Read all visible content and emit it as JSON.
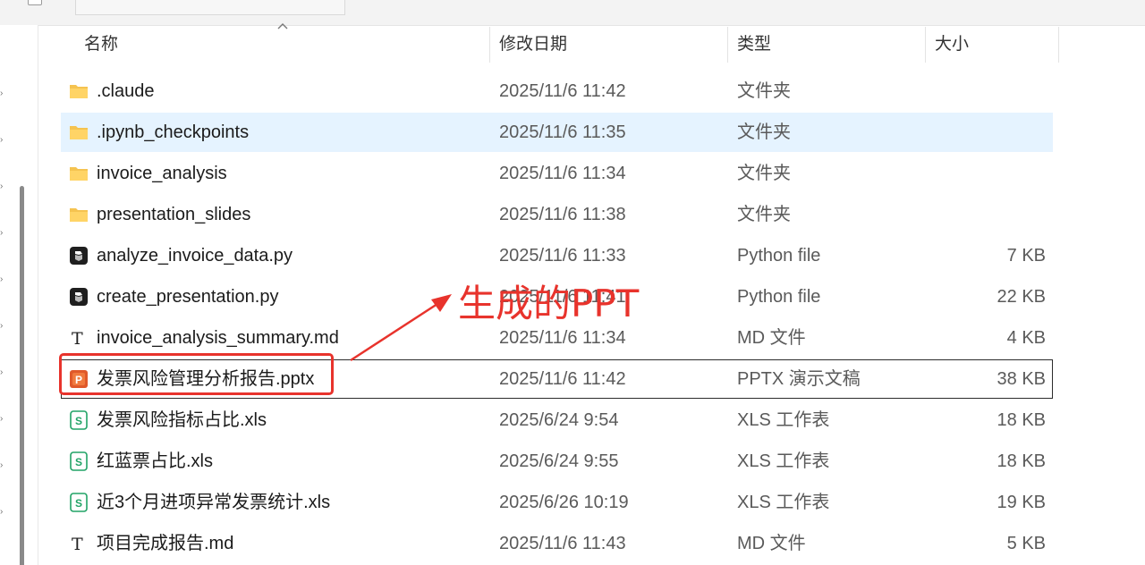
{
  "columns": {
    "name": "名称",
    "modified": "修改日期",
    "type": "类型",
    "size": "大小"
  },
  "files": [
    {
      "name": ".claude",
      "modified": "2025/11/6 11:42",
      "type": "文件夹",
      "size": "",
      "icon": "folder-icon"
    },
    {
      "name": ".ipynb_checkpoints",
      "modified": "2025/11/6 11:35",
      "type": "文件夹",
      "size": "",
      "icon": "folder-icon"
    },
    {
      "name": "invoice_analysis",
      "modified": "2025/11/6 11:34",
      "type": "文件夹",
      "size": "",
      "icon": "folder-icon"
    },
    {
      "name": "presentation_slides",
      "modified": "2025/11/6 11:38",
      "type": "文件夹",
      "size": "",
      "icon": "folder-icon"
    },
    {
      "name": "analyze_invoice_data.py",
      "modified": "2025/11/6 11:33",
      "type": "Python file",
      "size": "7 KB",
      "icon": "python-file-icon"
    },
    {
      "name": "create_presentation.py",
      "modified": "2025/11/6 11:41",
      "type": "Python file",
      "size": "22 KB",
      "icon": "python-file-icon"
    },
    {
      "name": "invoice_analysis_summary.md",
      "modified": "2025/11/6 11:34",
      "type": "MD 文件",
      "size": "4 KB",
      "icon": "markdown-file-icon"
    },
    {
      "name": "发票风险管理分析报告.pptx",
      "modified": "2025/11/6 11:42",
      "type": "PPTX 演示文稿",
      "size": "38 KB",
      "icon": "pptx-file-icon"
    },
    {
      "name": "发票风险指标占比.xls",
      "modified": "2025/6/24 9:54",
      "type": "XLS 工作表",
      "size": "18 KB",
      "icon": "xls-file-icon"
    },
    {
      "name": "红蓝票占比.xls",
      "modified": "2025/6/24 9:55",
      "type": "XLS 工作表",
      "size": "18 KB",
      "icon": "xls-file-icon"
    },
    {
      "name": "近3个月进项异常发票统计.xls",
      "modified": "2025/6/26 10:19",
      "type": "XLS 工作表",
      "size": "19 KB",
      "icon": "xls-file-icon"
    },
    {
      "name": "项目完成报告.md",
      "modified": "2025/11/6 11:43",
      "type": "MD 文件",
      "size": "5 KB",
      "icon": "markdown-file-icon"
    }
  ],
  "hover_row_index": 1,
  "selected_row_index": 7,
  "annotation": {
    "label": "生成的PPT",
    "color": "#e8332c"
  },
  "colors": {
    "hover": "#e5f3ff",
    "folder": "#f5c350",
    "python": "#1f1f1f",
    "pptx": "#e0592a",
    "xls": "#21a366"
  }
}
